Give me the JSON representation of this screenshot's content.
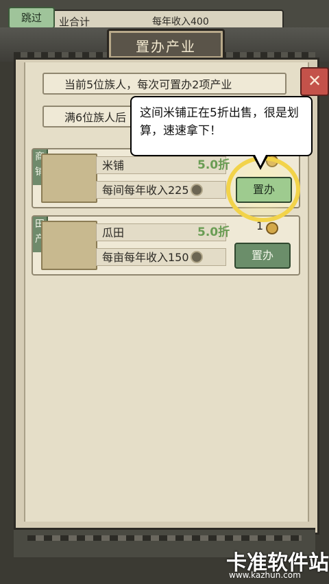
{
  "top": {
    "skip_label": "跳过",
    "left_text": "业合计",
    "right_text": "每年收入400"
  },
  "title": "置办产业",
  "info": {
    "line1": "当前5位族人，每次可置办2项产业",
    "line2": "满6位族人后"
  },
  "close_label": "✕",
  "tooltip": "这间米铺正在5折出售，很是划算，速速拿下！",
  "cards": [
    {
      "tag": "商铺",
      "name": "米铺",
      "discount": "5.0折",
      "income": "每间每年收入225",
      "button": "置办",
      "gold": ""
    },
    {
      "tag": "田产",
      "name": "瓜田",
      "discount": "5.0折",
      "income": "每亩每年收入150",
      "button": "置办",
      "gold": "1"
    }
  ],
  "watermark": {
    "title": "卡准软件站",
    "url": "www.kazhun.com"
  }
}
